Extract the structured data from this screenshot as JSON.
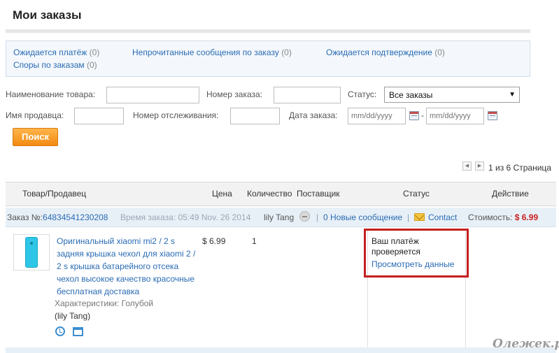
{
  "page": {
    "title": "Мои заказы"
  },
  "summary": {
    "awaiting_payment": {
      "label": "Ожидается платёж",
      "count": "(0)"
    },
    "unread_messages": {
      "label": "Непрочитанные сообщения по заказу",
      "count": "(0)"
    },
    "awaiting_confirmation": {
      "label": "Ожидается подтверждение",
      "count": "(0)"
    },
    "disputes": {
      "label": "Споры по заказам",
      "count": "(0)"
    }
  },
  "filters": {
    "product_name_label": "Наименование товара:",
    "order_number_label": "Номер заказа:",
    "status_label": "Статус:",
    "status_selected": "Все заказы",
    "seller_name_label": "Имя продавца:",
    "tracking_number_label": "Номер отслеживания:",
    "order_date_label": "Дата заказа:",
    "date_from_placeholder": "mm/dd/yyyy",
    "date_separator": "-",
    "date_to_placeholder": "mm/dd/yyyy",
    "search_button": "Поиск"
  },
  "pager": {
    "text": "1 из 6 Страница"
  },
  "table": {
    "headers": [
      "Товар/Продавец",
      "Цена",
      "Количество",
      "Поставщик",
      "Статус",
      "Действие"
    ]
  },
  "order": {
    "number_label": "Заказ №:",
    "number": "64834541230208",
    "time_label": "Время заказа:",
    "time": "05:49 Nov. 26 2014",
    "seller": "lily Tang",
    "separator": "|",
    "messages": "0 Новые сообщение",
    "contact": "Contact",
    "cost_label": "Стоимость:",
    "cost": "$ 6.99",
    "item": {
      "title_lines": [
        "Оригинальный xiaomi mi2 / 2 s",
        "задняя крышка чехол для xiaomi 2 /",
        "2 s крышка батарейного отсека",
        "чехол высокое качество красочные",
        "бесплатная доставка"
      ],
      "spec": "Характеристики: Голубой",
      "seller": "(lily Tang)",
      "price": "$ 6.99",
      "quantity": "1"
    },
    "status": {
      "lines": [
        "Ваш платёж",
        "проверяется"
      ],
      "view_details": "Просмотреть данные"
    }
  },
  "watermark": "Олежек.ру"
}
